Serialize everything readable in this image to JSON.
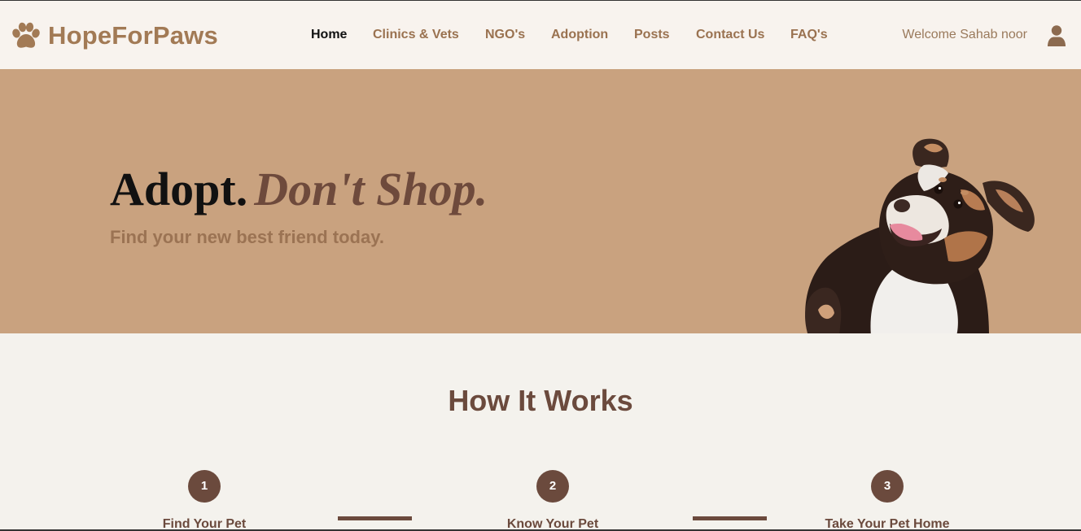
{
  "brand": {
    "name": "HopeForPaws",
    "icon": "paw-icon",
    "color": "#a27a55"
  },
  "nav": {
    "links": [
      {
        "label": "Home",
        "active": true
      },
      {
        "label": "Clinics & Vets",
        "active": false
      },
      {
        "label": "NGO's",
        "active": false
      },
      {
        "label": "Adoption",
        "active": false
      },
      {
        "label": "Posts",
        "active": false
      },
      {
        "label": "Contact Us",
        "active": false
      },
      {
        "label": "FAQ's",
        "active": false
      }
    ],
    "welcome": "Welcome Sahab noor",
    "user_icon": "user-icon"
  },
  "hero": {
    "title_part1": "Adopt.",
    "title_part2": "Don't Shop.",
    "subtitle": "Find your new best friend today.",
    "image": "dog-photo",
    "background_color": "#c9a27f"
  },
  "how_it_works": {
    "title": "How It Works",
    "steps": [
      {
        "number": "1",
        "label": "Find Your Pet"
      },
      {
        "number": "2",
        "label": "Know Your Pet"
      },
      {
        "number": "3",
        "label": "Take Your Pet Home"
      }
    ]
  },
  "colors": {
    "accent": "#6b4a3d",
    "nav_text": "#9a7250",
    "page_bg": "#f4f2ed",
    "nav_bg": "#f8f3ee"
  }
}
